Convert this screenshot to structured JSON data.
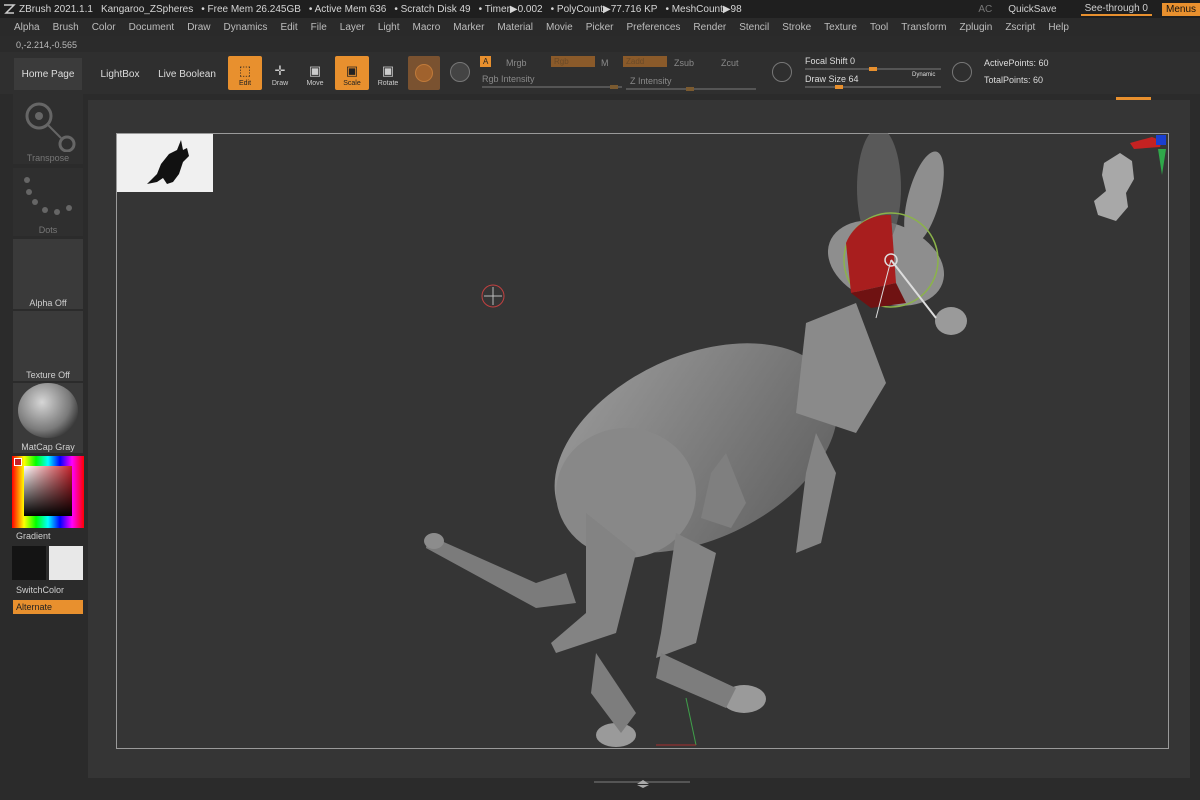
{
  "titlebar": {
    "app": "ZBrush 2021.1.1",
    "project": "Kangaroo_ZSpheres",
    "free_mem": "• Free Mem 26.245GB",
    "active_mem": "• Active Mem 636",
    "scratch": "• Scratch Disk 49",
    "timer": "• Timer▶0.002",
    "polycount": "• PolyCount▶77.716 KP",
    "meshcount": "• MeshCount▶98",
    "ac": "AC",
    "quicksave": "QuickSave",
    "see_through": "See-through  0",
    "menus": "Menus"
  },
  "menubar": [
    "Alpha",
    "Brush",
    "Color",
    "Document",
    "Draw",
    "Dynamics",
    "Edit",
    "File",
    "Layer",
    "Light",
    "Macro",
    "Marker",
    "Material",
    "Movie",
    "Picker",
    "Preferences",
    "Render",
    "Stencil",
    "Stroke",
    "Texture",
    "Tool",
    "Transform",
    "Zplugin",
    "Zscript",
    "Help"
  ],
  "coords": "0,-2.214,-0.565",
  "toolbar": {
    "home_page": "Home Page",
    "lightbox": "LightBox",
    "live_boolean": "Live Boolean",
    "edit": "Edit",
    "draw": "Draw",
    "move": "Move",
    "scale": "Scale",
    "rotate": "Rotate",
    "a": "A",
    "mrgb": "Mrgb",
    "rgb": "Rgb",
    "m": "M",
    "zadd": "Zadd",
    "zsub": "Zsub",
    "zcut": "Zcut",
    "rgb_intensity": "Rgb Intensity",
    "z_intensity": "Z Intensity",
    "focal_shift": "Focal Shift 0",
    "draw_size": "Draw Size 64",
    "dynamic": "Dynamic",
    "active_points": "ActivePoints: 60",
    "total_points": "TotalPoints: 60"
  },
  "leftpanel": {
    "transpose": "Transpose",
    "dots": "Dots",
    "alpha_off": "Alpha Off",
    "texture_off": "Texture Off",
    "matcap": "MatCap Gray",
    "gradient": "Gradient",
    "switchcolor": "SwitchColor",
    "alternate": "Alternate"
  },
  "colors": {
    "accent": "#e8902e",
    "bg": "#2b2b2b",
    "viewport": "#353535"
  }
}
